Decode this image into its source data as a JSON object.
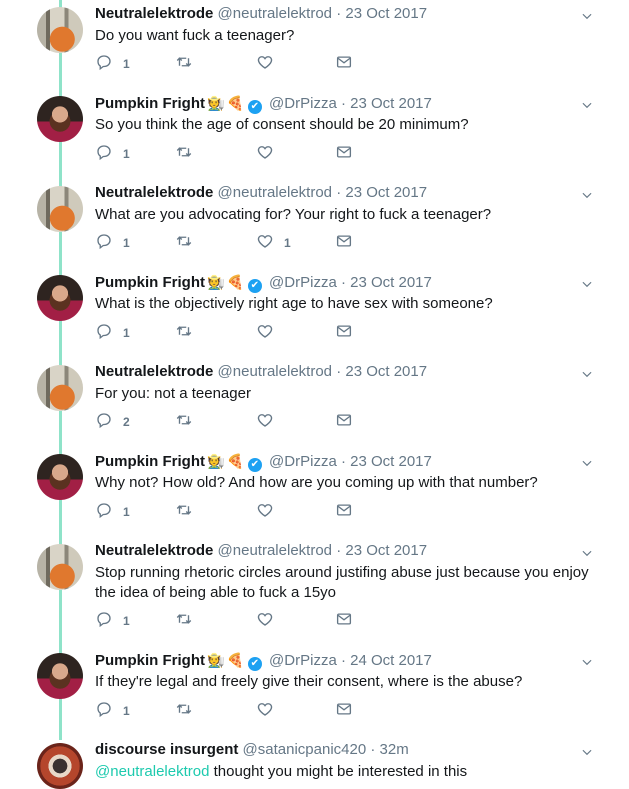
{
  "tweets": [
    {
      "name": "Neutralelektrode",
      "badges": [],
      "verified": false,
      "handle": "@neutralelektrod",
      "sep": "·",
      "date": "23 Oct 2017",
      "text": "Do you want fuck a teenager?",
      "replies": "1",
      "likes": ""
    },
    {
      "name": "Pumpkin Fright",
      "badges": [
        "🧑‍🌾",
        "🍕"
      ],
      "verified": true,
      "handle": "@DrPizza",
      "sep": "·",
      "date": "23 Oct 2017",
      "text": "So you think the age of consent should be 20 minimum?",
      "replies": "1",
      "likes": ""
    },
    {
      "name": "Neutralelektrode",
      "badges": [],
      "verified": false,
      "handle": "@neutralelektrod",
      "sep": "·",
      "date": "23 Oct 2017",
      "text": "What are you advocating for? Your right to fuck a teenager?",
      "replies": "1",
      "likes": "1"
    },
    {
      "name": "Pumpkin Fright",
      "badges": [
        "🧑‍🌾",
        "🍕"
      ],
      "verified": true,
      "handle": "@DrPizza",
      "sep": "·",
      "date": "23 Oct 2017",
      "text": "What is the objectively right age to have sex with someone?",
      "replies": "1",
      "likes": ""
    },
    {
      "name": "Neutralelektrode",
      "badges": [],
      "verified": false,
      "handle": "@neutralelektrod",
      "sep": "·",
      "date": "23 Oct 2017",
      "text": "For you: not a teenager",
      "replies": "2",
      "likes": ""
    },
    {
      "name": "Pumpkin Fright",
      "badges": [
        "🧑‍🌾",
        "🍕"
      ],
      "verified": true,
      "handle": "@DrPizza",
      "sep": "·",
      "date": "23 Oct 2017",
      "text": "Why not? How old? And how are you coming up with that number?",
      "replies": "1",
      "likes": ""
    },
    {
      "name": "Neutralelektrode",
      "badges": [],
      "verified": false,
      "handle": "@neutralelektrod",
      "sep": "·",
      "date": "23 Oct 2017",
      "text": "Stop running rhetoric circles around justifing abuse just because you enjoy the idea of being able to fuck a 15yo",
      "replies": "1",
      "likes": ""
    },
    {
      "name": "Pumpkin Fright",
      "badges": [
        "🧑‍🌾",
        "🍕"
      ],
      "verified": true,
      "handle": "@DrPizza",
      "sep": "·",
      "date": "24 Oct 2017",
      "text": "If they're legal and freely give their consent, where is the abuse?",
      "replies": "1",
      "likes": ""
    },
    {
      "name": "discourse insurgent",
      "badges": [],
      "verified": false,
      "handle": "@satanicpanic420",
      "sep": "·",
      "date": "32m",
      "mention": "@neutralelektrod",
      "text": " thought you might be interested in this",
      "replies": "",
      "likes": ""
    }
  ],
  "icons": {
    "reply": "reply-icon",
    "retweet": "retweet-icon",
    "like": "heart-icon",
    "dm": "envelope-icon",
    "more": "chevron-down-icon"
  },
  "colors": {
    "thread_line": "#8fe3c9",
    "mention": "#1dcaae",
    "verified": "#1da1f2",
    "muted": "#657786"
  }
}
